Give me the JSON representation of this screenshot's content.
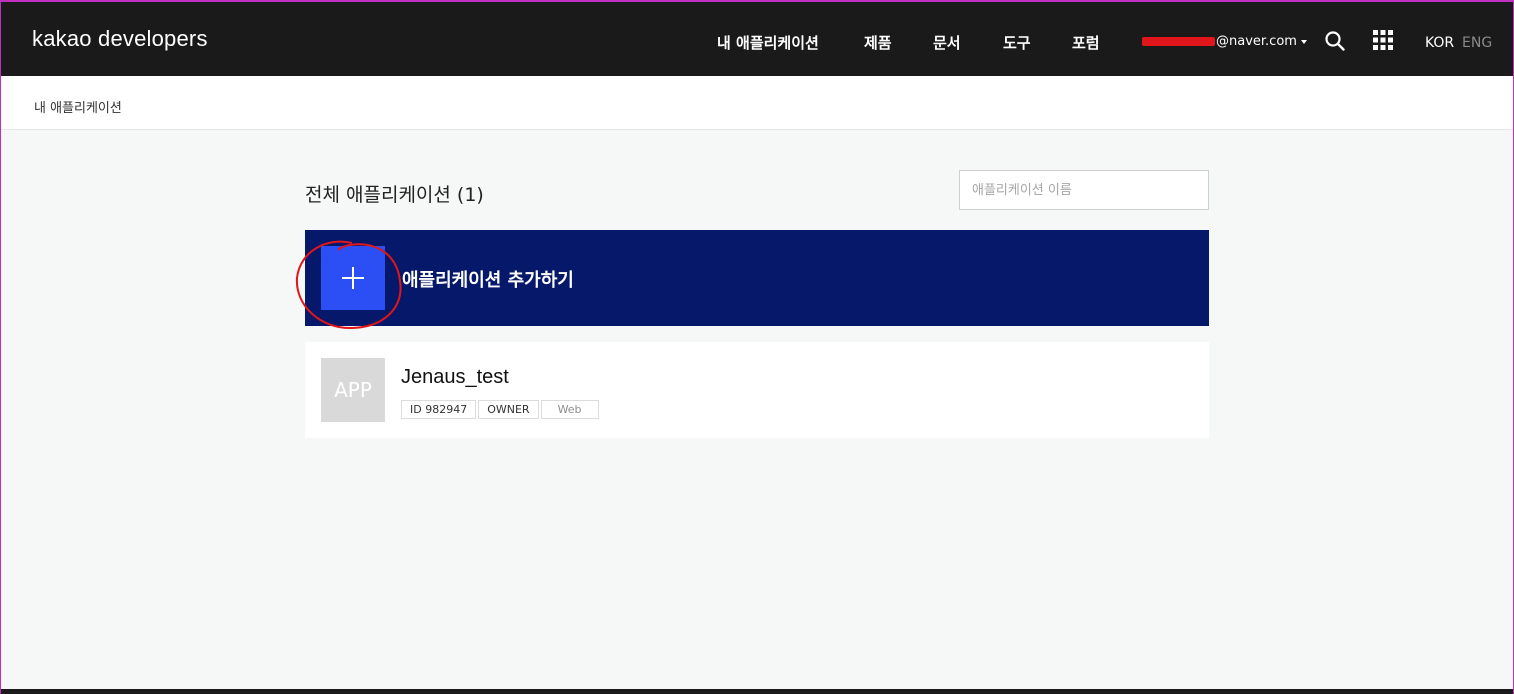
{
  "header": {
    "logo": "kakao developers",
    "nav": [
      "내 애플리케이션",
      "제품",
      "문서",
      "도구",
      "포럼"
    ],
    "account_visible": "@naver.com",
    "lang_active": "KOR",
    "lang_inactive": "ENG",
    "icons": [
      "search-icon",
      "apps-grid-icon",
      "chevron-down-icon"
    ]
  },
  "breadcrumb": "내 애플리케이션",
  "main": {
    "title": "전체 애플리케이션 (1)",
    "search_placeholder": "애플리케이션 이름",
    "add_label": "애플리케이션 추가하기",
    "add_icon": "plus-icon"
  },
  "apps": [
    {
      "thumb": "APP",
      "name": "Jenaus_test",
      "id_tag": "ID 982947",
      "role": "OWNER",
      "platform": "Web"
    }
  ],
  "colors": {
    "header_bg": "#1a1a1b",
    "add_card_bg": "#061869",
    "add_square": "#2b4ff5",
    "annotation_red": "#e0161a"
  }
}
